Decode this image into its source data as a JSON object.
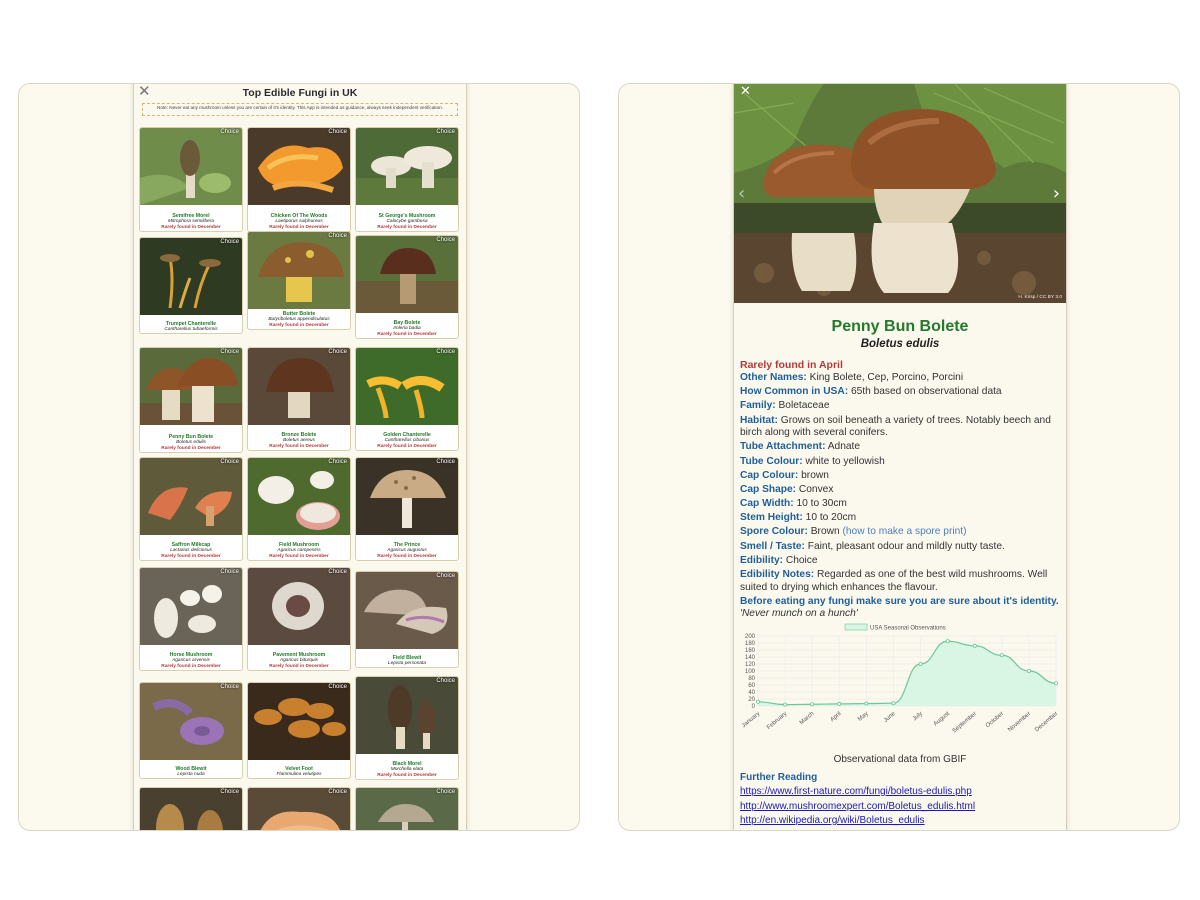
{
  "left_app": {
    "close_icon": "close-x-icon",
    "title": "Top Edible Fungi in UK",
    "note": "Note: Never eat any mushroom unless you are certain of it's identity. This App is intended as guidance, always seek independent verification.",
    "cards": [
      {
        "name": "Semifree Morel",
        "latin": "Mitrophora semilibera",
        "found": "Rarely found in December",
        "badge": "Choice",
        "scene": "morel"
      },
      {
        "name": "Chicken Of The Woods",
        "latin": "Laetiporus sulphureus",
        "found": "Rarely found in December",
        "badge": "Choice",
        "scene": "chicken"
      },
      {
        "name": "St George's Mushroom",
        "latin": "Calocybe gambosa",
        "found": "Rarely found in December",
        "badge": "Choice",
        "scene": "stgeorge"
      },
      {
        "name": "Trumpet Chanterelle",
        "latin": "Cantharellus tubaeformis",
        "found": "",
        "badge": "Choice",
        "scene": "trumpet"
      },
      {
        "name": "Butter Bolete",
        "latin": "Butyriboletus appendiculatus",
        "found": "Rarely found in December",
        "badge": "Choice",
        "scene": "butter"
      },
      {
        "name": "Bay Bolete",
        "latin": "Imleria badia",
        "found": "Rarely found in December",
        "badge": "Choice",
        "scene": "bay"
      },
      {
        "name": "Penny Bun Bolete",
        "latin": "Boletus edulis",
        "found": "Rarely found in December",
        "badge": "Choice",
        "scene": "pennybun"
      },
      {
        "name": "Bronze Bolete",
        "latin": "Boletus aereus",
        "found": "Rarely found in December",
        "badge": "Choice",
        "scene": "bronze"
      },
      {
        "name": "Golden Chanterelle",
        "latin": "Cantharellus cibarius",
        "found": "Rarely found in December",
        "badge": "Choice",
        "scene": "golden"
      },
      {
        "name": "Saffron Milkcap",
        "latin": "Lactarius deliciosus",
        "found": "Rarely found in December",
        "badge": "Choice",
        "scene": "saffron"
      },
      {
        "name": "Field Mushroom",
        "latin": "Agaricus campestris",
        "found": "Rarely found in December",
        "badge": "Choice",
        "scene": "field"
      },
      {
        "name": "The Prince",
        "latin": "Agaricus augustus",
        "found": "Rarely found in December",
        "badge": "Choice",
        "scene": "prince"
      },
      {
        "name": "Horse Mushroom",
        "latin": "Agaricus arvensis",
        "found": "Rarely found in December",
        "badge": "Choice",
        "scene": "horse"
      },
      {
        "name": "Pavement Mushroom",
        "latin": "Agaricus bitorquis",
        "found": "Rarely found in December",
        "badge": "Choice",
        "scene": "pavement"
      },
      {
        "name": "Field Blewit",
        "latin": "Lepista personata",
        "found": "",
        "badge": "Choice",
        "scene": "fieldblewit"
      },
      {
        "name": "Wood Blewit",
        "latin": "Lepista nuda",
        "found": "",
        "badge": "Choice",
        "scene": "woodblewit"
      },
      {
        "name": "Velvet Foot",
        "latin": "Flammulina velutipes",
        "found": "",
        "badge": "Choice",
        "scene": "velvet"
      },
      {
        "name": "Black Morel",
        "latin": "Morchella elata",
        "found": "Rarely found in December",
        "badge": "Choice",
        "scene": "blackmorel"
      },
      {
        "name": "",
        "latin": "",
        "found": "",
        "badge": "Choice",
        "scene": "morel2"
      },
      {
        "name": "",
        "latin": "",
        "found": "",
        "badge": "Choice",
        "scene": "hedgehog"
      },
      {
        "name": "",
        "latin": "",
        "found": "",
        "badge": "Choice",
        "scene": "parasol"
      }
    ]
  },
  "right_app": {
    "close_icon": "close-x-icon",
    "next_icon": "chevron-right-icon",
    "prev_icon": "chevron-left-icon",
    "photo_credit": "H. Krisp / CC BY 3.0",
    "title": "Penny Bun Bolete",
    "latin": "Boletus edulis",
    "rarity": "Rarely found in April",
    "fields": [
      {
        "label": "Other Names:",
        "value": "King Bolete, Cep, Porcino, Porcini"
      },
      {
        "label": "How Common in USA:",
        "value": "65th based on observational data"
      },
      {
        "label": "Family:",
        "value": "Boletaceae"
      },
      {
        "label": "Habitat:",
        "value": "Grows on soil beneath a variety of trees. Notably beech and birch along with several conifers."
      },
      {
        "label": "Tube Attachment:",
        "value": "Adnate"
      },
      {
        "label": "Tube Colour:",
        "value": "white to yellowish"
      },
      {
        "label": "Cap Colour:",
        "value": "brown"
      },
      {
        "label": "Cap Shape:",
        "value": "Convex"
      },
      {
        "label": "Cap Width:",
        "value": "10 to 30cm"
      },
      {
        "label": "Stem Height:",
        "value": "10 to 20cm"
      },
      {
        "label": "Spore Colour:",
        "value": "Brown",
        "link": "(how to make a spore print)"
      },
      {
        "label": "Smell / Taste:",
        "value": "Faint, pleasant odour and mildly nutty taste."
      },
      {
        "label": "Edibility:",
        "value": "Choice"
      },
      {
        "label": "Edibility Notes:",
        "value": "Regarded as one of the best wild mushrooms. Well suited to drying which enhances the flavour."
      }
    ],
    "warning": "Before eating any fungi make sure you are sure about it's identity.",
    "motto": "'Never munch on a hunch'",
    "chart_caption": "Observational data from GBIF",
    "further_heading": "Further Reading",
    "links": [
      "https://www.first-nature.com/fungi/boletus-edulis.php",
      "http://www.mushroomexpert.com/Boletus_edulis.html",
      "http://en.wikipedia.org/wiki/Boletus_edulis"
    ],
    "colors": {
      "title_green": "#237a2a",
      "label_blue": "#1f5f9a",
      "rare_red": "#b23a3a",
      "link_blue": "#4a7fc1",
      "series_fill": "#d9f5e4",
      "series_line": "#6cc79a"
    }
  },
  "chart_data": {
    "type": "area",
    "title": "",
    "legend": [
      "USA Seasonal Observations"
    ],
    "legend_position": "top-center",
    "categories": [
      "January",
      "February",
      "March",
      "April",
      "May",
      "June",
      "July",
      "August",
      "September",
      "October",
      "November",
      "December"
    ],
    "series": [
      {
        "name": "USA Seasonal Observations",
        "values": [
          12,
          4,
          5,
          6,
          7,
          8,
          120,
          185,
          172,
          145,
          100,
          65
        ]
      }
    ],
    "ylim": [
      0,
      200
    ],
    "yticks": [
      0,
      20,
      40,
      60,
      80,
      100,
      120,
      140,
      160,
      180,
      200
    ],
    "grid": true
  }
}
